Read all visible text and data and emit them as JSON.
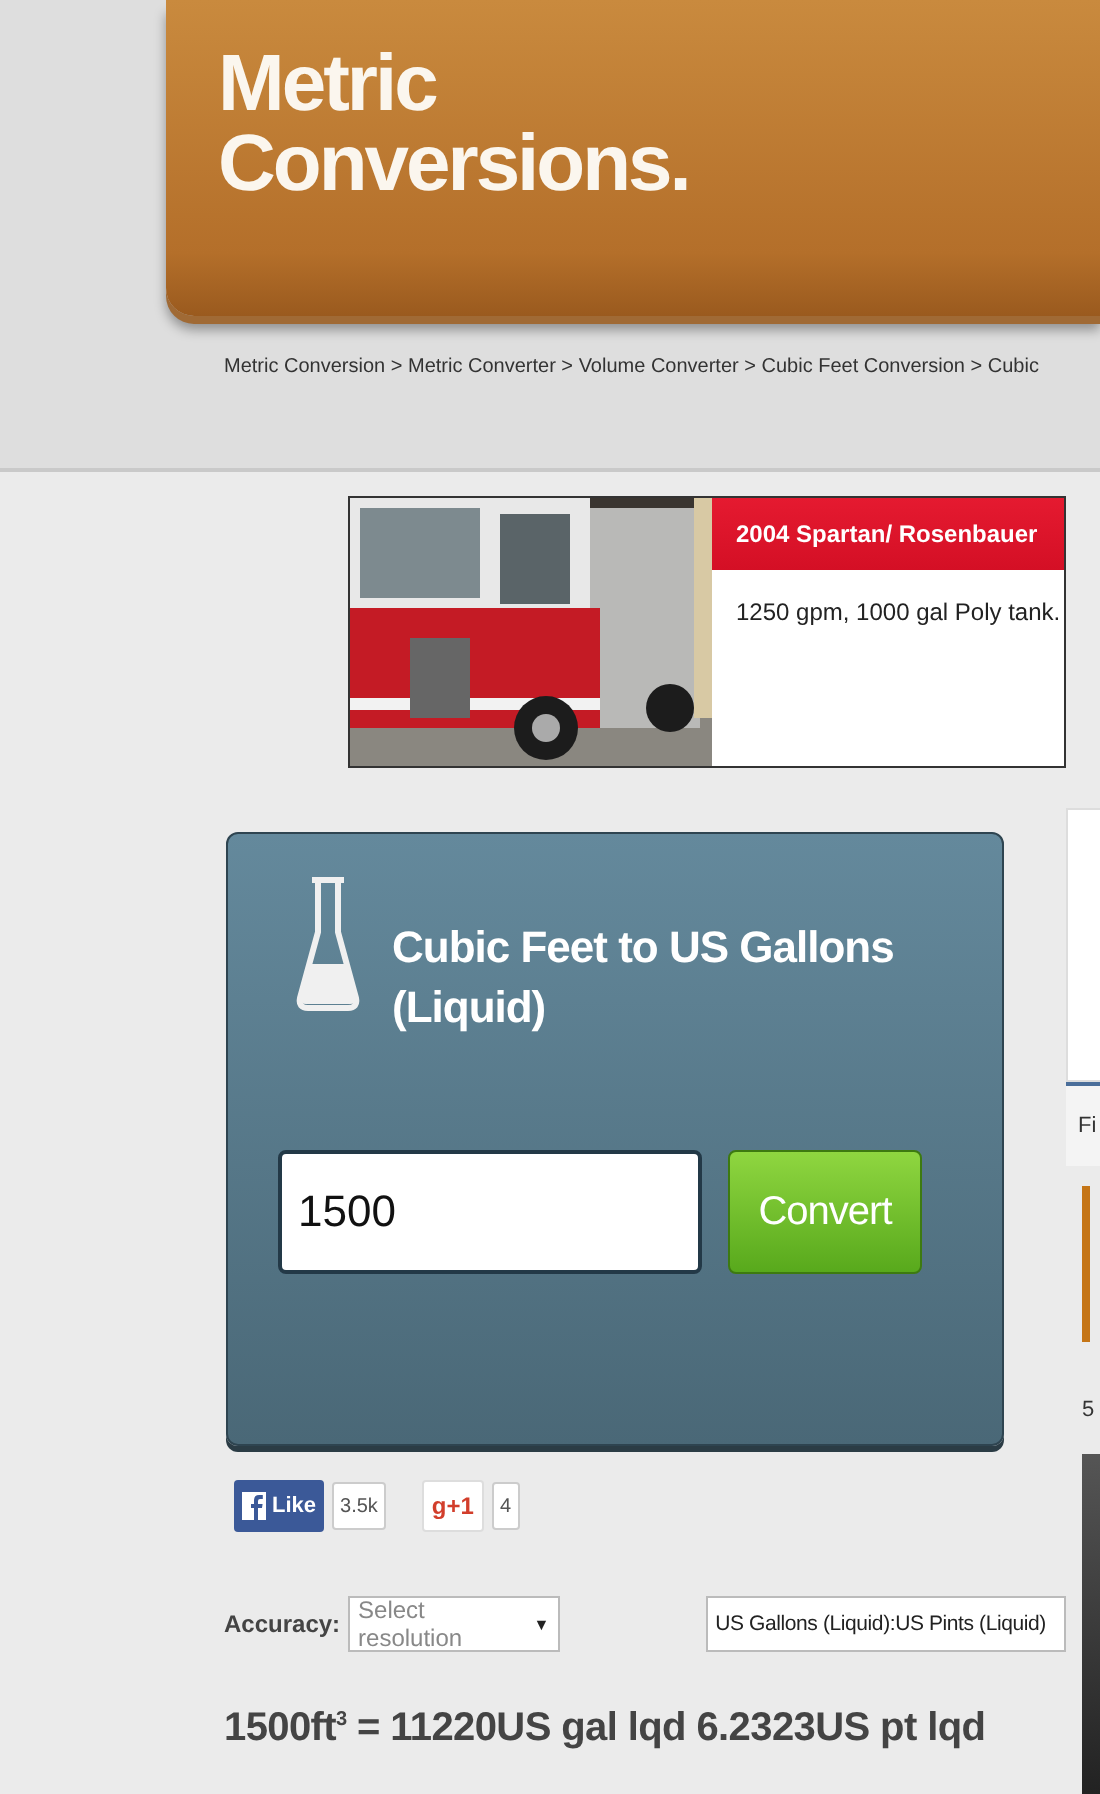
{
  "header": {
    "logo_lines": [
      "Metric",
      "Conversions."
    ]
  },
  "breadcrumb": {
    "separator": ">",
    "items": [
      "Metric Conversion",
      "Metric Converter",
      "Volume Converter",
      "Cubic Feet Conversion",
      "Cubic"
    ]
  },
  "ad": {
    "kind": "picture",
    "title": "2004 Spartan/ Rosenbauer",
    "text": "1250 gpm, 1000 gal Poly tank."
  },
  "converter": {
    "title": "Cubic Feet to US Gallons (Liquid)",
    "input_value": "1500",
    "button": "Convert"
  },
  "social": {
    "like_label": "Like",
    "like_count": "3.5k",
    "plus_label": "g+1",
    "plus_count": "4"
  },
  "options": {
    "accuracy_label": "Accuracy:",
    "accuracy_placeholder": "Select resolution",
    "caret": "▼",
    "unit_select": "US Gallons (Liquid):US Pints (Liquid)"
  },
  "result": "1500ft$^{3}$ = 11220US gal lqd 6.2323US pt lqd",
  "sidebar": {
    "tab_label": "Fi",
    "number": "5"
  }
}
